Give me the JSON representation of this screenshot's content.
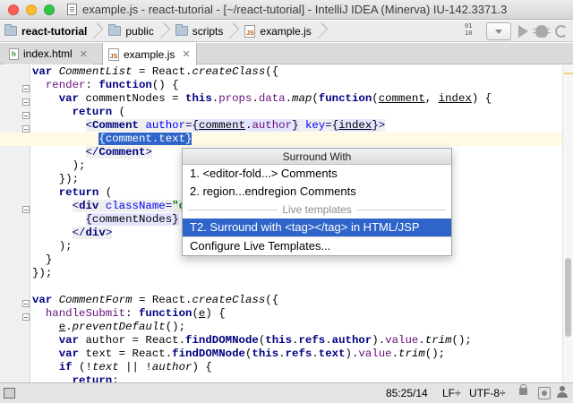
{
  "window": {
    "title": "example.js - react-tutorial - [~/react-tutorial] - IntelliJ IDEA (Minerva) IU-142.3371.3"
  },
  "breadcrumbs": [
    "react-tutorial",
    "public",
    "scripts",
    "example.js"
  ],
  "tabs": [
    {
      "label": "index.html",
      "active": false
    },
    {
      "label": "example.js",
      "active": true
    }
  ],
  "popup": {
    "title": "Surround With",
    "items": [
      "1. <editor-fold...> Comments",
      "2. region...endregion Comments"
    ],
    "separator": "Live templates",
    "live_items": [
      "T2. Surround with <tag></tag> in HTML/JSP"
    ],
    "footer": "Configure Live Templates..."
  },
  "status": {
    "position": "85:25/14",
    "line_separator": "LF÷",
    "encoding": "UTF-8÷"
  },
  "colors": {
    "selection": "#2f65ca",
    "keyword": "#000080",
    "string": "#008000",
    "current_line": "#fffae3"
  },
  "icons": [
    "file-icon",
    "folder-icon",
    "js-file-icon",
    "html-file-icon",
    "build-icon",
    "run-icon",
    "debug-icon",
    "rerun-icon",
    "lock-icon",
    "git-icon",
    "person-icon"
  ]
}
